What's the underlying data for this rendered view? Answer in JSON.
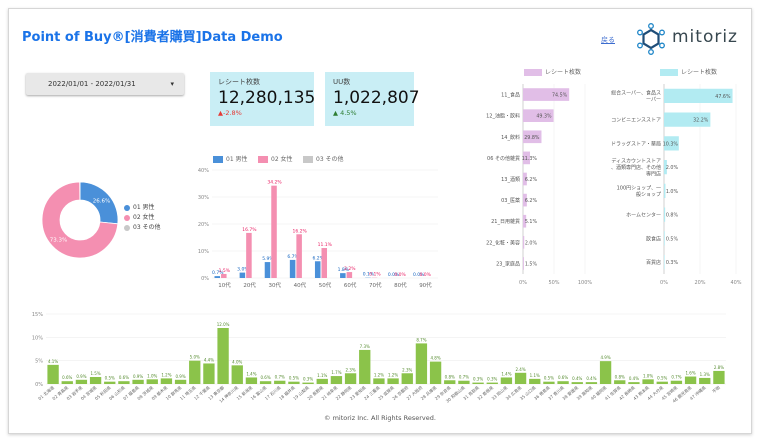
{
  "header": {
    "title": "Point of Buy®[消費者購買]Data Demo",
    "return_link": "戻る",
    "logo": "mitoriz"
  },
  "date_range": {
    "label": "2022/01/01 - 2022/01/31",
    "caret": "▾"
  },
  "kpis": [
    {
      "title": "レシート枚数",
      "value": "12,280,135",
      "delta": "▲-2.8%"
    },
    {
      "title": "UU数",
      "value": "1,022,807",
      "delta": "▲ 4.5%"
    }
  ],
  "donut": {
    "slices": [
      {
        "label": "01 男性",
        "value": 26.6,
        "color": "#4a90d9",
        "pct_label": "26.6%"
      },
      {
        "label": "02 女性",
        "value": 73.3,
        "color": "#f48fb1",
        "pct_label": "73.3%"
      },
      {
        "label": "03 その他",
        "value": 0.1,
        "color": "#c8c8c8",
        "pct_label": ""
      }
    ]
  },
  "colors": {
    "male": "#4a90d9",
    "female": "#f48fb1",
    "other": "#c8c8c8",
    "cat": "#e1bee7",
    "store": "#b2ebf2",
    "pref": "#8bc34a"
  },
  "chart_data": [
    {
      "type": "bar",
      "legend": [
        "01 男性",
        "02 女性",
        "03 その他"
      ],
      "categories": [
        "10代",
        "20代",
        "30代",
        "40代",
        "50代",
        "60代",
        "70代",
        "80代",
        "90代"
      ],
      "series": [
        {
          "name": "01 男性",
          "values": [
            0.7,
            2.0,
            5.9,
            6.7,
            6.2,
            1.8,
            0.1,
            0.0,
            0.0
          ],
          "labels": [
            "0.7%",
            "3.0%",
            "5.9%",
            "6.7%",
            "6.2%",
            "1.8%",
            "0.1%",
            "0.0%",
            "0.0%"
          ]
        },
        {
          "name": "02 女性",
          "values": [
            1.5,
            16.7,
            34.2,
            16.2,
            11.1,
            2.2,
            0.1,
            0.0,
            0.0
          ],
          "labels": [
            "1.5%",
            "16.7%",
            "34.2%",
            "16.2%",
            "11.1%",
            "2.2%",
            "0.1%",
            "0.0%",
            "0.0%"
          ]
        },
        {
          "name": "03 その他",
          "values": [
            0,
            0,
            0,
            0,
            0,
            0,
            0,
            0,
            0
          ],
          "labels": []
        }
      ],
      "yticks": [
        "0%",
        "10%",
        "20%",
        "30%",
        "40%"
      ],
      "ylim": [
        0,
        40
      ]
    },
    {
      "type": "bar",
      "orientation": "horizontal",
      "legend": [
        "レシート枚数"
      ],
      "categories": [
        "11_食品",
        "12_油脂・飲料",
        "14_飲料",
        "06 その他雑貨",
        "13_酒類",
        "03_医薬",
        "21_日用雑貨",
        "22_化粧・美容",
        "23_家庭品"
      ],
      "values": [
        74.5,
        49.3,
        29.8,
        11.3,
        6.2,
        6.2,
        5.1,
        2.0,
        1.5
      ],
      "labels": [
        "74.5%",
        "49.3%",
        "29.8%",
        "11.3%",
        "6.2%",
        "6.2%",
        "5.1%",
        "2.0%",
        "1.5%"
      ],
      "xticks": [
        "0%",
        "50%",
        "100%"
      ],
      "xlim": [
        0,
        100
      ]
    },
    {
      "type": "bar",
      "orientation": "horizontal",
      "legend": [
        "レシート枚数"
      ],
      "categories": [
        "総合スーパー、食品スーパー",
        "コンビニエンスストア",
        "ドラッグストア・薬局",
        "ディスカウントストア、酒類専門店、その他専門店",
        "100円ショップ、一般ショップ",
        "ホームセンター",
        "飲食店",
        "百貨店"
      ],
      "values": [
        47.6,
        32.2,
        10.3,
        2.0,
        1.0,
        0.8,
        0.5,
        0.3
      ],
      "labels": [
        "47.6%",
        "32.2%",
        "10.3%",
        "2.0%",
        "1.0%",
        "0.8%",
        "0.5%",
        "0.3%"
      ],
      "xticks": [
        "0%",
        "20%",
        "40%"
      ],
      "xlim": [
        0,
        50
      ]
    },
    {
      "type": "bar",
      "categories": [
        "01 北海道",
        "02 青森県",
        "03 岩手県",
        "04 宮城県",
        "05 秋田県",
        "06 山形県",
        "07 福島県",
        "08 茨城県",
        "09 栃木県",
        "10 群馬県",
        "11 埼玉県",
        "12 千葉県",
        "13 東京都",
        "14 神奈川県",
        "15 新潟県",
        "16 富山県",
        "17 石川県",
        "18 福井県",
        "19 山梨県",
        "20 長野県",
        "21 岐阜県",
        "22 静岡県",
        "23 愛知県",
        "24 三重県",
        "25 滋賀県",
        "26 京都府",
        "27 大阪府",
        "28 兵庫県",
        "29 奈良県",
        "30 和歌山県",
        "31 鳥取県",
        "32 島根県",
        "33 岡山県",
        "34 広島県",
        "35 山口県",
        "36 徳島県",
        "37 香川県",
        "38 愛媛県",
        "39 高知県",
        "40 福岡県",
        "41 佐賀県",
        "42 長崎県",
        "43 熊本県",
        "44 大分県",
        "45 宮崎県",
        "46 鹿児島県",
        "47 沖縄県",
        "不明"
      ],
      "values": [
        4.1,
        0.6,
        0.9,
        1.5,
        0.5,
        0.6,
        0.9,
        1.0,
        1.2,
        0.9,
        5.0,
        4.4,
        12.0,
        4.0,
        1.4,
        0.6,
        0.7,
        0.5,
        0.3,
        1.1,
        1.7,
        2.3,
        7.3,
        1.2,
        1.2,
        2.3,
        8.7,
        4.8,
        0.8,
        0.7,
        0.3,
        0.3,
        1.4,
        2.4,
        1.1,
        0.5,
        0.6,
        0.4,
        0.4,
        4.9,
        0.8,
        0.4,
        1.0,
        0.5,
        0.7,
        1.6,
        1.3,
        2.8
      ],
      "labels": [
        "4.1%",
        "0.6%",
        "0.9%",
        "1.5%",
        "0.5%",
        "0.6%",
        "0.9%",
        "1.0%",
        "1.2%",
        "0.9%",
        "5.0%",
        "4.4%",
        "12.0%",
        "4.0%",
        "1.4%",
        "0.6%",
        "0.7%",
        "0.5%",
        "0.3%",
        "1.1%",
        "1.7%",
        "2.3%",
        "7.3%",
        "1.2%",
        "1.2%",
        "2.3%",
        "8.7%",
        "4.8%",
        "0.8%",
        "0.7%",
        "0.3%",
        "0.3%",
        "1.4%",
        "2.4%",
        "1.1%",
        "0.5%",
        "0.6%",
        "0.4%",
        "0.4%",
        "4.9%",
        "0.8%",
        "0.4%",
        "1.0%",
        "0.5%",
        "0.7%",
        "1.6%",
        "1.3%",
        "2.8%"
      ],
      "yticks": [
        "0%",
        "5%",
        "10%",
        "15%"
      ],
      "ylim": [
        0,
        15
      ]
    }
  ],
  "footer": "© mitoriz Inc. All Rights Reserved."
}
